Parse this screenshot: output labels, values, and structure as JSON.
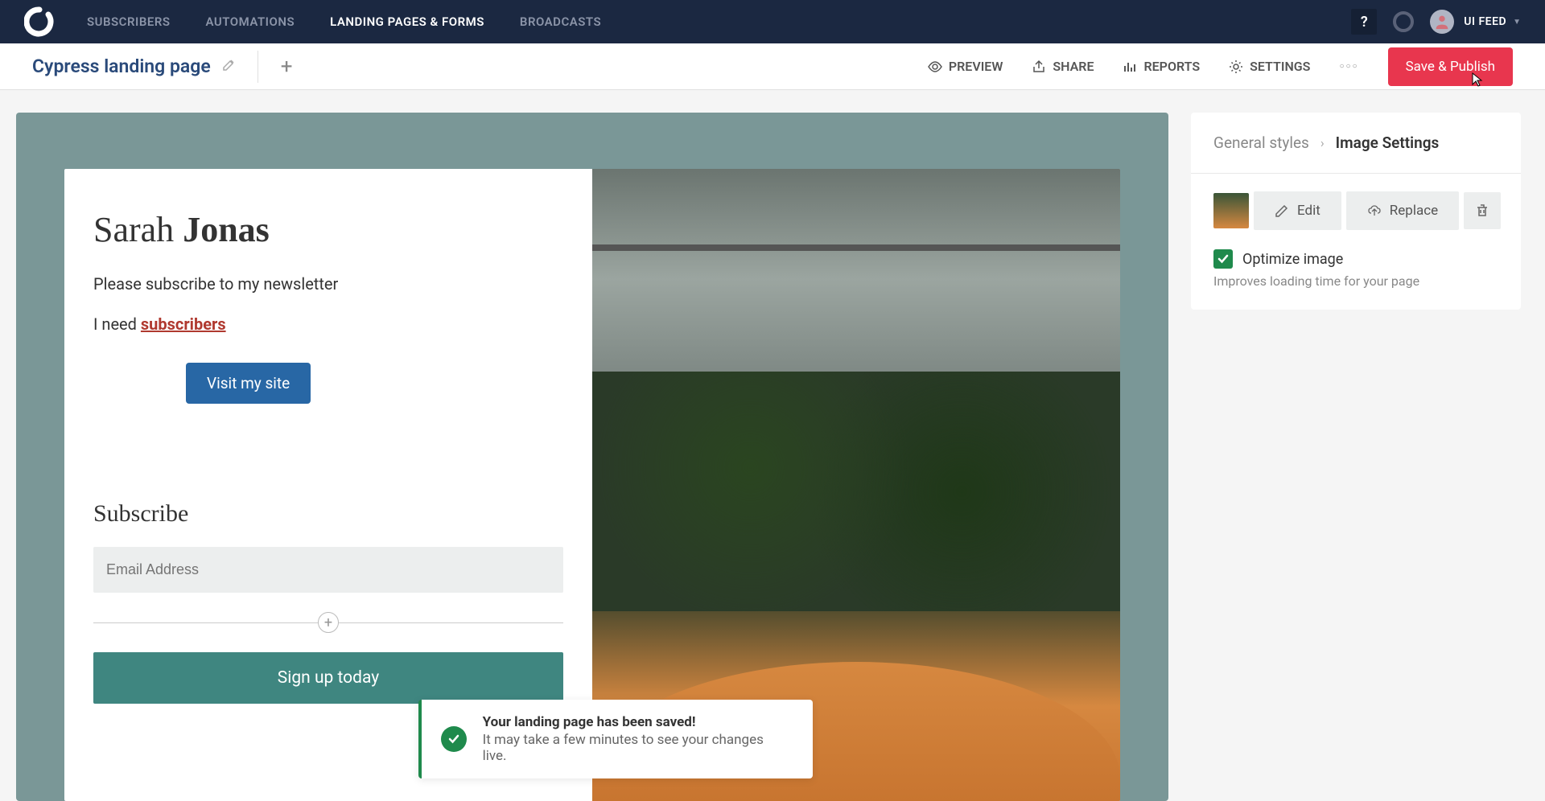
{
  "nav": {
    "items": [
      "SUBSCRIBERS",
      "AUTOMATIONS",
      "LANDING PAGES & FORMS",
      "BROADCASTS"
    ],
    "activeIndex": 2,
    "user": "UI FEED",
    "help": "?"
  },
  "subnav": {
    "title": "Cypress landing page",
    "actions": {
      "preview": "PREVIEW",
      "share": "SHARE",
      "reports": "REPORTS",
      "settings": "SETTINGS"
    },
    "save": "Save & Publish"
  },
  "landing": {
    "name_first": "Sarah ",
    "name_last": "Jonas",
    "subtitle": "Please subscribe to my newsletter",
    "need_prefix": "I need ",
    "need_link": "subscribers",
    "visit_btn": "Visit my site",
    "subscribe_title": "Subscribe",
    "email_placeholder": "Email Address",
    "signup_btn": "Sign up today"
  },
  "toast": {
    "title": "Your landing page has been saved!",
    "message": "It may take a few minutes to see your changes live."
  },
  "sidebar": {
    "breadcrumb": {
      "root": "General styles",
      "current": "Image Settings"
    },
    "edit": "Edit",
    "replace": "Replace",
    "optimize_label": "Optimize image",
    "optimize_help": "Improves loading time for your page"
  }
}
